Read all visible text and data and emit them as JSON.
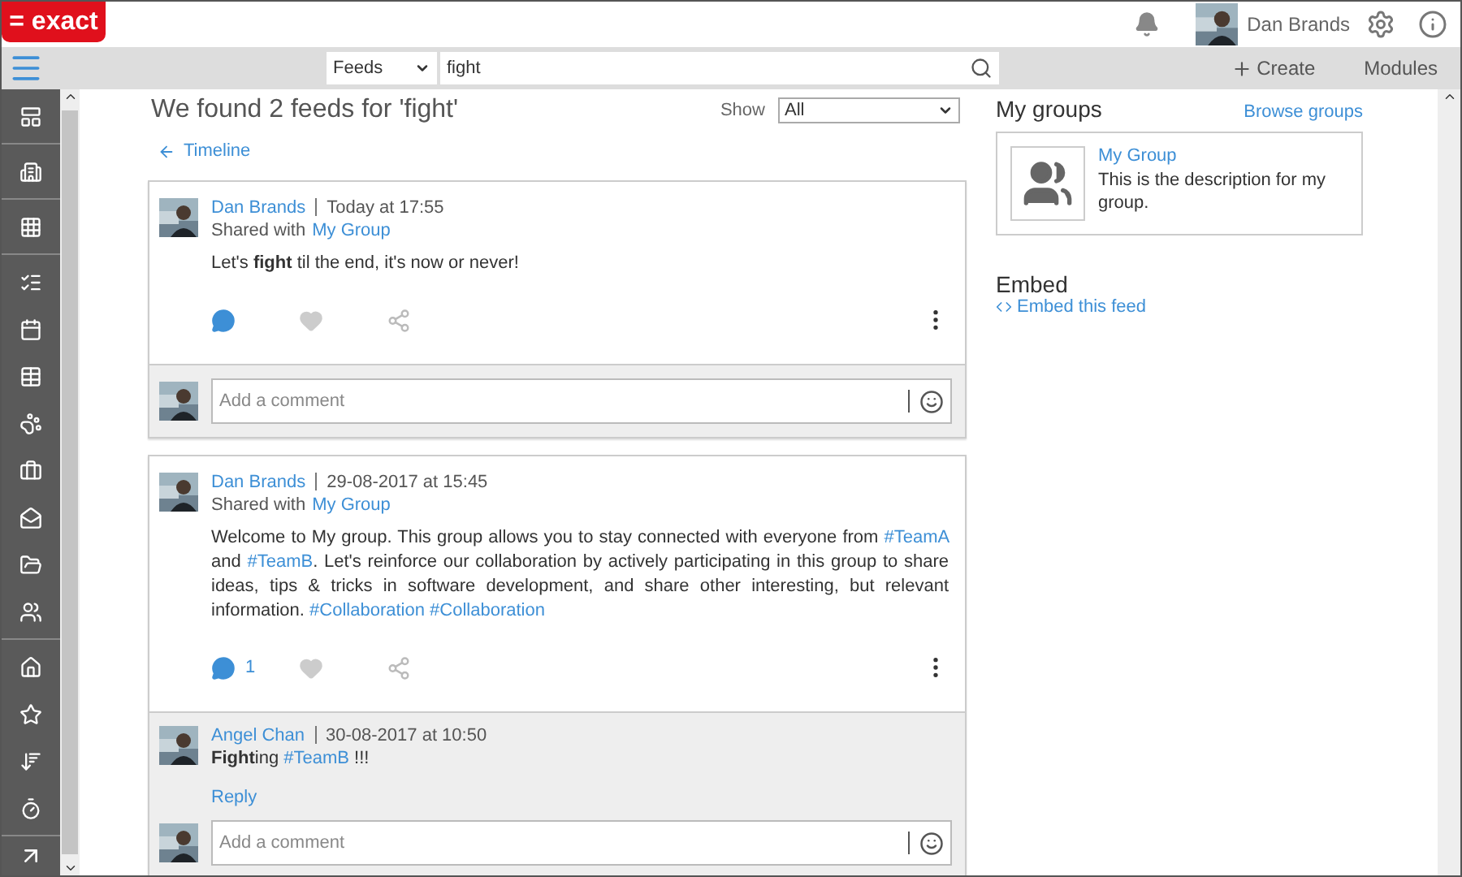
{
  "header": {
    "logo": "= exact",
    "user_name": "Dan Brands"
  },
  "toolbar": {
    "search_scope": "Feeds",
    "search_value": "fight",
    "create": "Create",
    "modules": "Modules"
  },
  "results": {
    "heading": "We found 2 feeds for 'fight'",
    "show_label": "Show",
    "show_value": "All",
    "back_link": "Timeline"
  },
  "posts": [
    {
      "author": "Dan Brands",
      "time": "Today at 17:55",
      "shared_label": "Shared with",
      "shared_group": "My Group",
      "body": [
        {
          "kind": "text",
          "text": "Let's "
        },
        {
          "kind": "bold",
          "text": "fight"
        },
        {
          "kind": "text",
          "text": " til the end, it's now or never!"
        }
      ],
      "comment_placeholder": "Add a comment"
    },
    {
      "author": "Dan Brands",
      "time": "29-08-2017 at 15:45",
      "shared_label": "Shared with",
      "shared_group": "My Group",
      "body": [
        {
          "kind": "text",
          "text": "Welcome to My group. This group allows you to stay connected with everyone from "
        },
        {
          "kind": "tag",
          "text": "#TeamA"
        },
        {
          "kind": "text",
          "text": " and "
        },
        {
          "kind": "tag",
          "text": "#TeamB"
        },
        {
          "kind": "text",
          "text": ". Let's reinforce our collaboration by actively participating in this group to share ideas, tips & tricks in software development, and share other interesting, but relevant information. "
        },
        {
          "kind": "tag",
          "text": "#Collaboration"
        },
        {
          "kind": "tag",
          "text": "#Collaboration"
        }
      ],
      "comment_count": "1",
      "replies": [
        {
          "author": "Angel Chan",
          "time": "30-08-2017 at 10:50",
          "body": [
            {
              "kind": "bold",
              "text": "Fight"
            },
            {
              "kind": "text",
              "text": "ing "
            },
            {
              "kind": "tag",
              "text": "#TeamB"
            },
            {
              "kind": "text",
              "text": " !!!"
            }
          ],
          "reply_link": "Reply"
        }
      ],
      "comment_placeholder": "Add a comment"
    }
  ],
  "sidebar_right": {
    "groups_title": "My groups",
    "browse_link": "Browse groups",
    "group": {
      "name": "My Group",
      "description": "This is the description for my group."
    },
    "embed_title": "Embed",
    "embed_link": "Embed this feed"
  }
}
